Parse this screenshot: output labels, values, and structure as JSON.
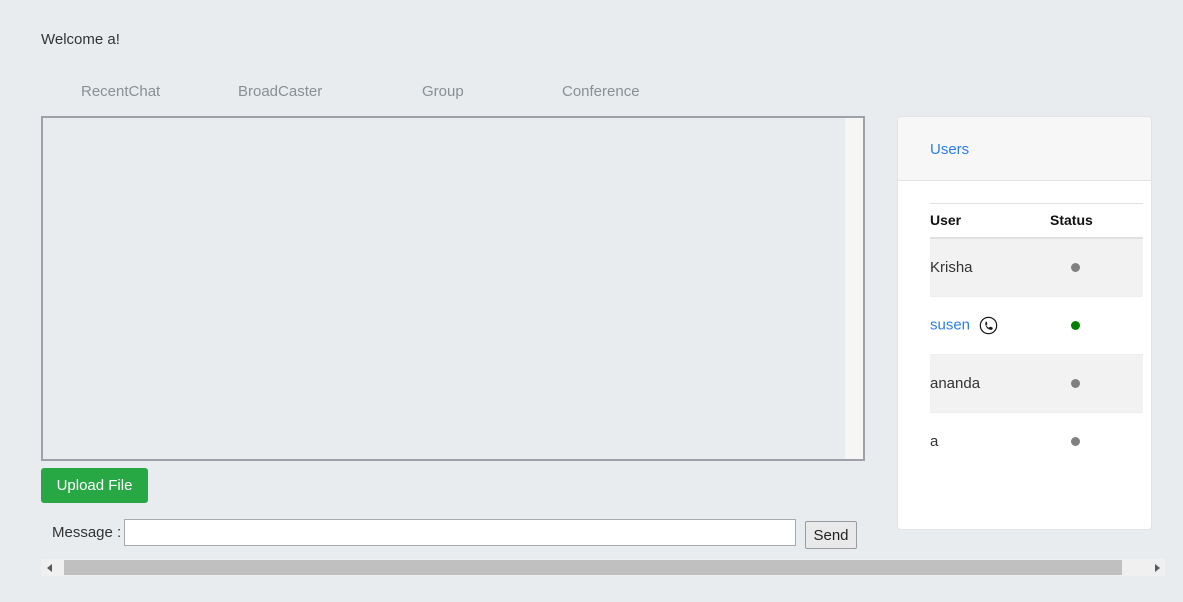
{
  "header": {
    "welcome_text": "Welcome a!"
  },
  "tabs": [
    {
      "label": "RecentChat"
    },
    {
      "label": "BroadCaster"
    },
    {
      "label": "Group"
    },
    {
      "label": "Conference"
    }
  ],
  "chat": {
    "messages": []
  },
  "actions": {
    "upload_label": "Upload File",
    "send_label": "Send"
  },
  "message_bar": {
    "label": "Message :",
    "value": "",
    "placeholder": ""
  },
  "users_panel": {
    "header_link": "Users",
    "columns": [
      "User",
      "Status"
    ],
    "rows": [
      {
        "name": "Krisha",
        "is_link": false,
        "has_call_icon": false,
        "status": "offline"
      },
      {
        "name": "susen",
        "is_link": true,
        "has_call_icon": true,
        "status": "online"
      },
      {
        "name": "ananda",
        "is_link": false,
        "has_call_icon": false,
        "status": "offline"
      },
      {
        "name": "a",
        "is_link": false,
        "has_call_icon": false,
        "status": "offline"
      }
    ]
  },
  "scrollbar": {
    "left_arrow_icon": "triangle-left-icon",
    "right_arrow_icon": "triangle-right-icon"
  },
  "colors": {
    "page_background": "#e8ecef",
    "accent_link": "#2a7fe8",
    "upload_button": "#28a745",
    "status_online": "#008000",
    "status_offline": "#808080"
  }
}
